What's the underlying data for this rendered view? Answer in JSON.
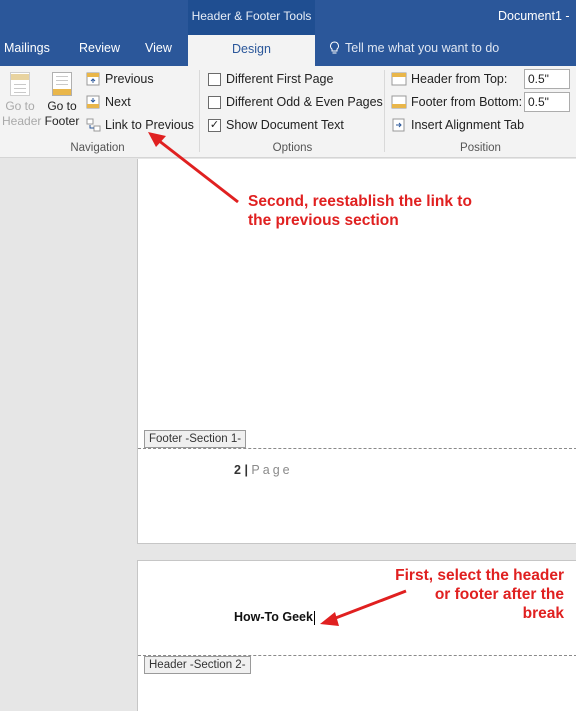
{
  "titlebar": {
    "context_group": "Header & Footer Tools",
    "document_title": "Document1 -",
    "tabs": [
      "Mailings",
      "Review",
      "View"
    ],
    "active_tab": "Design",
    "tell_me": "Tell me what you want to do"
  },
  "ribbon": {
    "navigation": {
      "label": "Navigation",
      "go_to_header": [
        "Go to",
        "Header"
      ],
      "go_to_footer": [
        "Go to",
        "Footer"
      ],
      "previous": "Previous",
      "next": "Next",
      "link_to_previous": "Link to Previous"
    },
    "options": {
      "label": "Options",
      "different_first_page": "Different First Page",
      "different_odd_even": "Different Odd & Even Pages",
      "show_document_text": "Show Document Text",
      "show_document_text_checked": true
    },
    "position": {
      "label": "Position",
      "header_from_top": "Header from Top:",
      "header_from_top_value": "0.5\"",
      "footer_from_bottom": "Footer from Bottom:",
      "footer_from_bottom_value": "0.5\"",
      "insert_alignment_tab": "Insert Alignment Tab"
    }
  },
  "document": {
    "footer_label": "Footer -Section 1-",
    "page_number": "2",
    "page_separator": "|",
    "page_word": "Page",
    "header_label": "Header -Section 2-",
    "header_text": "How-To Geek"
  },
  "annotations": {
    "second": [
      "Second, reestablish the link to",
      "the previous section"
    ],
    "first": [
      "First, select the header",
      "or footer after the",
      "break"
    ],
    "color": "#e02020"
  }
}
